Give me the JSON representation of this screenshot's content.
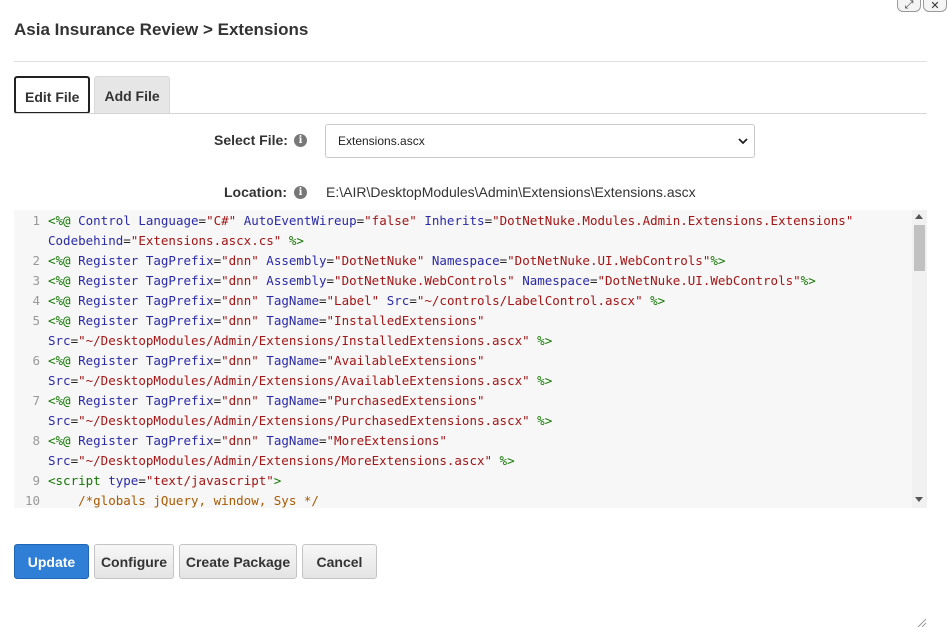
{
  "window": {
    "title": "Asia Insurance Review > Extensions",
    "controls": {
      "expand_icon": "expand-icon",
      "close_icon": "close-icon",
      "expand_glyph": "⤢",
      "close_glyph": "✕"
    }
  },
  "tabs": [
    {
      "label": "Edit File",
      "active": true
    },
    {
      "label": "Add File",
      "active": false
    }
  ],
  "select_file": {
    "label": "Select File:",
    "value": "Extensions.ascx",
    "info_glyph": "i"
  },
  "location": {
    "label": "Location:",
    "value": "E:\\AIR\\DesktopModules\\Admin\\Extensions\\Extensions.ascx",
    "info_glyph": "i"
  },
  "code_lines": [
    {
      "num": "1",
      "segments": [
        {
          "t": "<%@ ",
          "c": "tag"
        },
        {
          "t": "Control",
          "c": "kw"
        },
        {
          "t": " ",
          "c": "txt"
        },
        {
          "t": "Language",
          "c": "kw"
        },
        {
          "t": "=",
          "c": "txt"
        },
        {
          "t": "\"C#\"",
          "c": "str"
        },
        {
          "t": " ",
          "c": "txt"
        },
        {
          "t": "AutoEventWireup",
          "c": "kw"
        },
        {
          "t": "=",
          "c": "txt"
        },
        {
          "t": "\"false\"",
          "c": "str"
        },
        {
          "t": " ",
          "c": "txt"
        },
        {
          "t": "Inherits",
          "c": "kw"
        },
        {
          "t": "=",
          "c": "txt"
        },
        {
          "t": "\"DotNetNuke.Modules.Admin.Extensions.Extensions\"",
          "c": "str"
        }
      ]
    },
    {
      "num": "",
      "segments": [
        {
          "t": "Codebehind",
          "c": "kw"
        },
        {
          "t": "=",
          "c": "txt"
        },
        {
          "t": "\"Extensions.ascx.cs\"",
          "c": "str"
        },
        {
          "t": " %>",
          "c": "tag"
        }
      ]
    },
    {
      "num": "2",
      "segments": [
        {
          "t": "<%@ ",
          "c": "tag"
        },
        {
          "t": "Register",
          "c": "kw"
        },
        {
          "t": " ",
          "c": "txt"
        },
        {
          "t": "TagPrefix",
          "c": "kw"
        },
        {
          "t": "=",
          "c": "txt"
        },
        {
          "t": "\"dnn\"",
          "c": "str"
        },
        {
          "t": " ",
          "c": "txt"
        },
        {
          "t": "Assembly",
          "c": "kw"
        },
        {
          "t": "=",
          "c": "txt"
        },
        {
          "t": "\"DotNetNuke\"",
          "c": "str"
        },
        {
          "t": " ",
          "c": "txt"
        },
        {
          "t": "Namespace",
          "c": "kw"
        },
        {
          "t": "=",
          "c": "txt"
        },
        {
          "t": "\"DotNetNuke.UI.WebControls\"",
          "c": "str"
        },
        {
          "t": "%>",
          "c": "tag"
        }
      ]
    },
    {
      "num": "3",
      "segments": [
        {
          "t": "<%@ ",
          "c": "tag"
        },
        {
          "t": "Register",
          "c": "kw"
        },
        {
          "t": " ",
          "c": "txt"
        },
        {
          "t": "TagPrefix",
          "c": "kw"
        },
        {
          "t": "=",
          "c": "txt"
        },
        {
          "t": "\"dnn\"",
          "c": "str"
        },
        {
          "t": " ",
          "c": "txt"
        },
        {
          "t": "Assembly",
          "c": "kw"
        },
        {
          "t": "=",
          "c": "txt"
        },
        {
          "t": "\"DotNetNuke.WebControls\"",
          "c": "str"
        },
        {
          "t": " ",
          "c": "txt"
        },
        {
          "t": "Namespace",
          "c": "kw"
        },
        {
          "t": "=",
          "c": "txt"
        },
        {
          "t": "\"DotNetNuke.UI.WebControls\"",
          "c": "str"
        },
        {
          "t": "%>",
          "c": "tag"
        }
      ]
    },
    {
      "num": "4",
      "segments": [
        {
          "t": "<%@ ",
          "c": "tag"
        },
        {
          "t": "Register",
          "c": "kw"
        },
        {
          "t": " ",
          "c": "txt"
        },
        {
          "t": "TagPrefix",
          "c": "kw"
        },
        {
          "t": "=",
          "c": "txt"
        },
        {
          "t": "\"dnn\"",
          "c": "str"
        },
        {
          "t": " ",
          "c": "txt"
        },
        {
          "t": "TagName",
          "c": "kw"
        },
        {
          "t": "=",
          "c": "txt"
        },
        {
          "t": "\"Label\"",
          "c": "str"
        },
        {
          "t": " ",
          "c": "txt"
        },
        {
          "t": "Src",
          "c": "kw"
        },
        {
          "t": "=",
          "c": "txt"
        },
        {
          "t": "\"~/controls/LabelControl.ascx\"",
          "c": "str"
        },
        {
          "t": " %>",
          "c": "tag"
        }
      ]
    },
    {
      "num": "5",
      "segments": [
        {
          "t": "<%@ ",
          "c": "tag"
        },
        {
          "t": "Register",
          "c": "kw"
        },
        {
          "t": " ",
          "c": "txt"
        },
        {
          "t": "TagPrefix",
          "c": "kw"
        },
        {
          "t": "=",
          "c": "txt"
        },
        {
          "t": "\"dnn\"",
          "c": "str"
        },
        {
          "t": " ",
          "c": "txt"
        },
        {
          "t": "TagName",
          "c": "kw"
        },
        {
          "t": "=",
          "c": "txt"
        },
        {
          "t": "\"InstalledExtensions\"",
          "c": "str"
        }
      ]
    },
    {
      "num": "",
      "segments": [
        {
          "t": "Src",
          "c": "kw"
        },
        {
          "t": "=",
          "c": "txt"
        },
        {
          "t": "\"~/DesktopModules/Admin/Extensions/InstalledExtensions.ascx\"",
          "c": "str"
        },
        {
          "t": " %>",
          "c": "tag"
        }
      ]
    },
    {
      "num": "6",
      "segments": [
        {
          "t": "<%@ ",
          "c": "tag"
        },
        {
          "t": "Register",
          "c": "kw"
        },
        {
          "t": " ",
          "c": "txt"
        },
        {
          "t": "TagPrefix",
          "c": "kw"
        },
        {
          "t": "=",
          "c": "txt"
        },
        {
          "t": "\"dnn\"",
          "c": "str"
        },
        {
          "t": " ",
          "c": "txt"
        },
        {
          "t": "TagName",
          "c": "kw"
        },
        {
          "t": "=",
          "c": "txt"
        },
        {
          "t": "\"AvailableExtensions\"",
          "c": "str"
        }
      ]
    },
    {
      "num": "",
      "segments": [
        {
          "t": "Src",
          "c": "kw"
        },
        {
          "t": "=",
          "c": "txt"
        },
        {
          "t": "\"~/DesktopModules/Admin/Extensions/AvailableExtensions.ascx\"",
          "c": "str"
        },
        {
          "t": " %>",
          "c": "tag"
        }
      ]
    },
    {
      "num": "7",
      "segments": [
        {
          "t": "<%@ ",
          "c": "tag"
        },
        {
          "t": "Register",
          "c": "kw"
        },
        {
          "t": " ",
          "c": "txt"
        },
        {
          "t": "TagPrefix",
          "c": "kw"
        },
        {
          "t": "=",
          "c": "txt"
        },
        {
          "t": "\"dnn\"",
          "c": "str"
        },
        {
          "t": " ",
          "c": "txt"
        },
        {
          "t": "TagName",
          "c": "kw"
        },
        {
          "t": "=",
          "c": "txt"
        },
        {
          "t": "\"PurchasedExtensions\"",
          "c": "str"
        }
      ]
    },
    {
      "num": "",
      "segments": [
        {
          "t": "Src",
          "c": "kw"
        },
        {
          "t": "=",
          "c": "txt"
        },
        {
          "t": "\"~/DesktopModules/Admin/Extensions/PurchasedExtensions.ascx\"",
          "c": "str"
        },
        {
          "t": " %>",
          "c": "tag"
        }
      ]
    },
    {
      "num": "8",
      "segments": [
        {
          "t": "<%@ ",
          "c": "tag"
        },
        {
          "t": "Register",
          "c": "kw"
        },
        {
          "t": " ",
          "c": "txt"
        },
        {
          "t": "TagPrefix",
          "c": "kw"
        },
        {
          "t": "=",
          "c": "txt"
        },
        {
          "t": "\"dnn\"",
          "c": "str"
        },
        {
          "t": " ",
          "c": "txt"
        },
        {
          "t": "TagName",
          "c": "kw"
        },
        {
          "t": "=",
          "c": "txt"
        },
        {
          "t": "\"MoreExtensions\"",
          "c": "str"
        }
      ]
    },
    {
      "num": "",
      "segments": [
        {
          "t": "Src",
          "c": "kw"
        },
        {
          "t": "=",
          "c": "txt"
        },
        {
          "t": "\"~/DesktopModules/Admin/Extensions/MoreExtensions.ascx\"",
          "c": "str"
        },
        {
          "t": " %>",
          "c": "tag"
        }
      ]
    },
    {
      "num": "9",
      "segments": [
        {
          "t": "<script ",
          "c": "tag"
        },
        {
          "t": "type",
          "c": "kw"
        },
        {
          "t": "=",
          "c": "txt"
        },
        {
          "t": "\"text/javascript\"",
          "c": "str"
        },
        {
          "t": ">",
          "c": "tag"
        }
      ]
    },
    {
      "num": "10",
      "segments": [
        {
          "t": "    /*globals jQuery, window, Sys */",
          "c": "cm"
        }
      ]
    }
  ],
  "buttons": {
    "update": "Update",
    "configure": "Configure",
    "create_package": "Create Package",
    "cancel": "Cancel"
  }
}
